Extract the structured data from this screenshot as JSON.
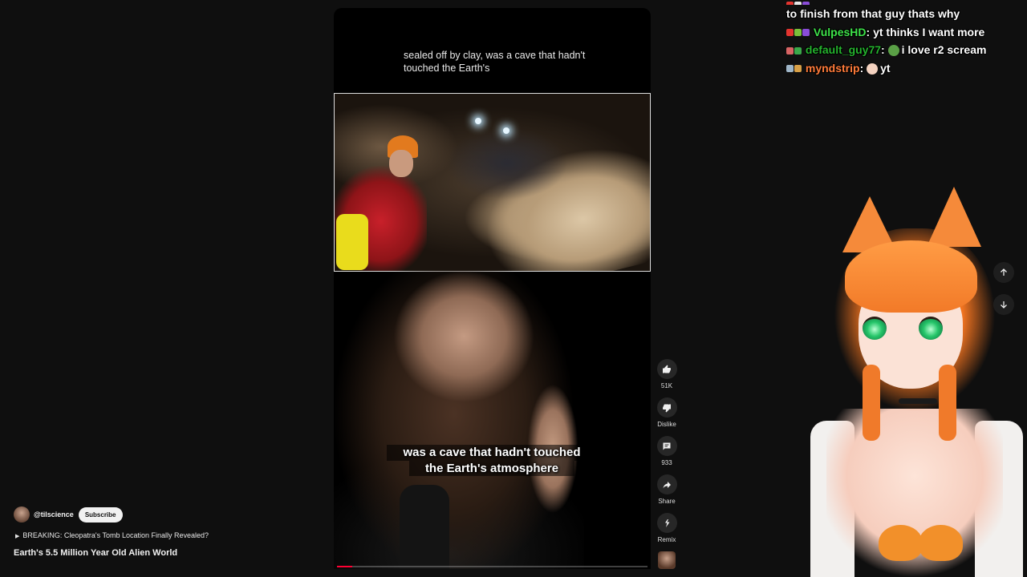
{
  "player": {
    "top_caption": "sealed off by clay, was a cave that hadn't touched the Earth's",
    "burned_caption_line1": "was a cave that hadn't touched",
    "burned_caption_line2": "the Earth's atmosphere",
    "progress": 0.05
  },
  "actions": {
    "like": {
      "icon": "thumbs-up-icon",
      "label": "51K"
    },
    "dislike": {
      "icon": "thumbs-down-icon",
      "label": "Dislike"
    },
    "comments": {
      "icon": "comment-icon",
      "label": "933"
    },
    "share": {
      "icon": "share-icon",
      "label": "Share"
    },
    "remix": {
      "icon": "remix-icon",
      "label": "Remix"
    }
  },
  "video": {
    "channel_handle": "@tilscience",
    "subscribe_label": "Subscribe",
    "related_link": "BREAKING: Cleopatra's Tomb Location Finally Revealed?",
    "title": "Earth's 5.5 Million Year Old Alien World"
  },
  "nav": {
    "up_icon": "arrow-up-icon",
    "down_icon": "arrow-down-icon"
  },
  "chat": {
    "line0_text": "to finish from that guy thats why",
    "line1_user": "VulpesHD",
    "line1_user_color": "#3ee24a",
    "line1_text": "yt thinks I want more",
    "line2_user": "default_guy77",
    "line2_user_color": "#25b22e",
    "line2_text": "i love r2 scream",
    "line3_user": "myndstrip",
    "line3_user_color": "#ff7b3a",
    "line3_text": "yt"
  },
  "colors": {
    "background": "#0f0f0f",
    "progress_red": "#ff0033",
    "button_bg": "#272727"
  }
}
